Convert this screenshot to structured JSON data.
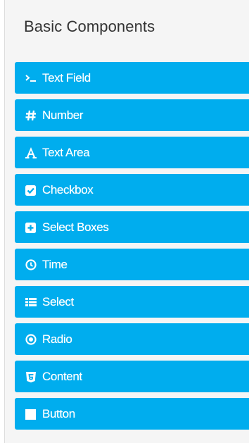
{
  "panel": {
    "title": "Basic Components"
  },
  "components": [
    {
      "label": "Text Field",
      "icon": "terminal-icon"
    },
    {
      "label": "Number",
      "icon": "hash-icon"
    },
    {
      "label": "Text Area",
      "icon": "font-icon"
    },
    {
      "label": "Checkbox",
      "icon": "check-square-icon"
    },
    {
      "label": "Select Boxes",
      "icon": "plus-square-icon"
    },
    {
      "label": "Time",
      "icon": "clock-icon"
    },
    {
      "label": "Select",
      "icon": "list-icon"
    },
    {
      "label": "Radio",
      "icon": "dot-circle-icon"
    },
    {
      "label": "Content",
      "icon": "html5-icon"
    },
    {
      "label": "Button",
      "icon": "stop-icon"
    }
  ],
  "colors": {
    "button_bg": "#00adee",
    "button_text": "#ffffff",
    "panel_bg": "#f5f5f5",
    "title_text": "#333333"
  }
}
